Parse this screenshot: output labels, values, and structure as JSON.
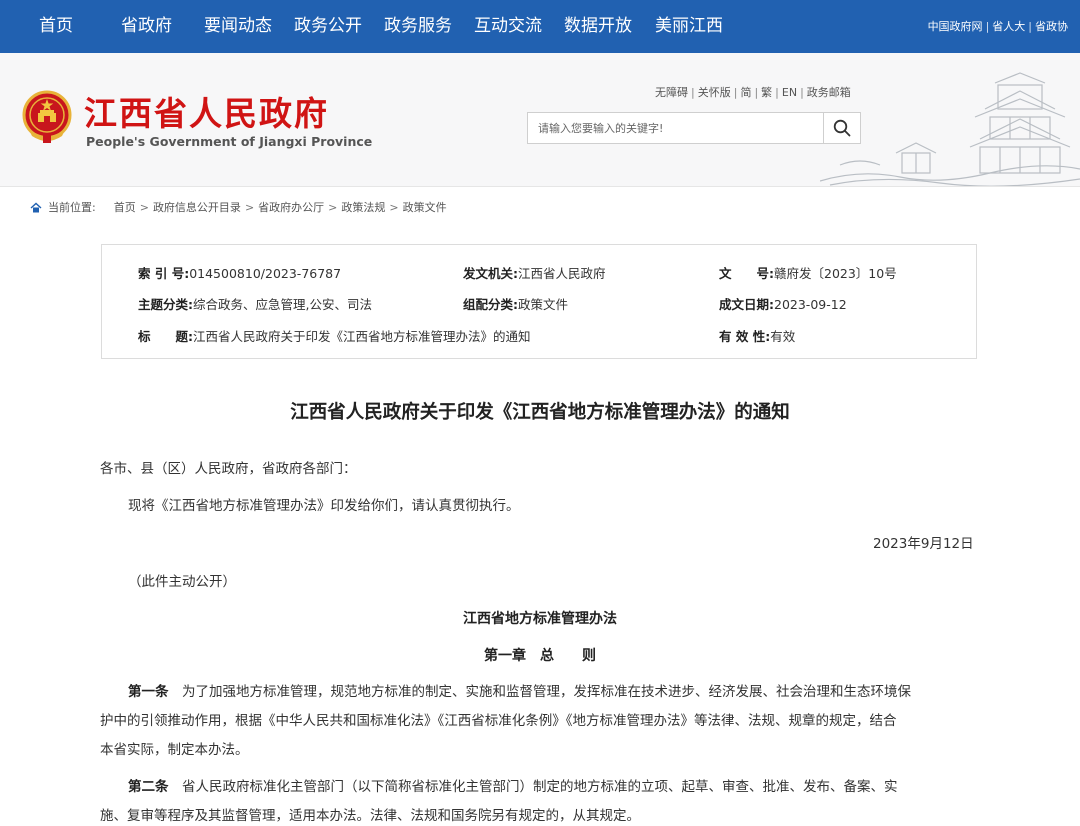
{
  "nav": {
    "items": [
      "首页",
      "省政府",
      "要闻动态",
      "政务公开",
      "政务服务",
      "互动交流",
      "数据开放",
      "美丽江西"
    ],
    "right_links": [
      "中国政府网",
      "省人大",
      "省政协"
    ]
  },
  "header": {
    "title": "江西省人民政府",
    "subtitle": "People's Government of Jiangxi Province",
    "util_links": [
      "无障碍",
      "关怀版",
      "简",
      "繁",
      "EN",
      "政务邮箱"
    ],
    "search_placeholder": "请输入您要输入的关键字!"
  },
  "breadcrumb": {
    "label": "当前位置:",
    "items": [
      "首页",
      "政府信息公开目录",
      "省政府办公厅",
      "政策法规",
      "政策文件"
    ]
  },
  "meta": {
    "index_label": "索 引 号:",
    "index_value": "014500810/2023-76787",
    "issuer_label": "发文机关:",
    "issuer_value": "江西省人民政府",
    "docno_label": "文　　号:",
    "docno_value": "赣府发〔2023〕10号",
    "topic_label": "主题分类:",
    "topic_value": "综合政务、应急管理,公安、司法",
    "genre_label": "组配分类:",
    "genre_value": "政策文件",
    "date_label": "成文日期:",
    "date_value": "2023-09-12",
    "title_label": "标　　题:",
    "title_value": "江西省人民政府关于印发《江西省地方标准管理办法》的通知",
    "validity_label": "有 效 性:",
    "validity_value": "有效"
  },
  "document": {
    "title": "江西省人民政府关于印发《江西省地方标准管理办法》的通知",
    "salutation": "各市、县（区）人民政府，省政府各部门：",
    "intro": "现将《江西省地方标准管理办法》印发给你们，请认真贯彻执行。",
    "date": "2023年9月12日",
    "public_note": "（此件主动公开）",
    "measures_title": "江西省地方标准管理办法",
    "chapter_title": "第一章　总　　则",
    "article1_label": "第一条",
    "article1_line1": "　为了加强地方标准管理，规范地方标准的制定、实施和监督管理，发挥标准在技术进步、经济发展、社会治理和生态环境保",
    "article1_line2": "护中的引领推动作用，根据《中华人民共和国标准化法》《江西省标准化条例》《地方标准管理办法》等法律、法规、规章的规定，结合",
    "article1_line3": "本省实际，制定本办法。",
    "article2_label": "第二条",
    "article2_line1": "　省人民政府标准化主管部门（以下简称省标准化主管部门）制定的地方标准的立项、起草、审查、批准、发布、备案、实",
    "article2_line2": "施、复审等程序及其监督管理，适用本办法。法律、法规和国务院另有规定的，从其规定。"
  }
}
